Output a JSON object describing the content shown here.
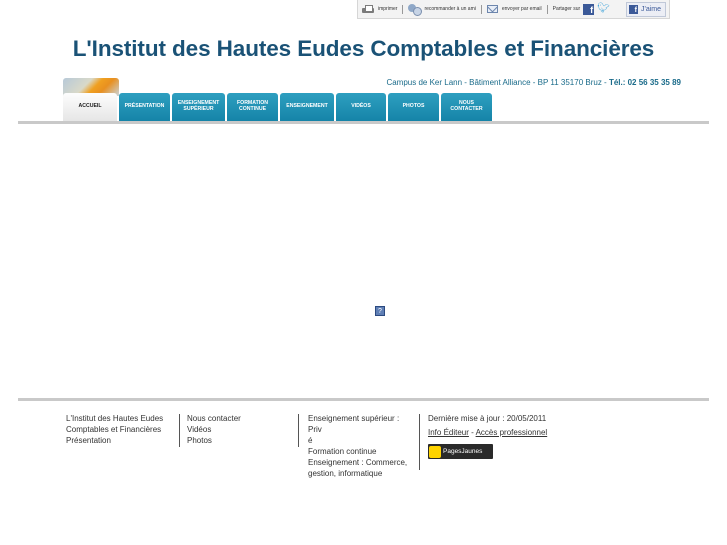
{
  "toolbar": {
    "print_label": "imprimer",
    "recommend_label": "recommander à un ami",
    "email_label": "envoyer par email",
    "share_label": "Partager sur",
    "like_label": "J'aime"
  },
  "header": {
    "title": "L'Institut des Hautes Eudes Comptables et Financières",
    "address": "Campus de Ker Lann - Bâtiment Alliance - BP 11 35170 Bruz - ",
    "phone": "Tél.: 02 56 35 35 89"
  },
  "nav": {
    "items": [
      {
        "label": "ACCUEIL"
      },
      {
        "label": "PRÉSENTATION"
      },
      {
        "label": "ENSEIGNEMENT SUPÉRIEUR"
      },
      {
        "label": "FORMATION CONTINUE"
      },
      {
        "label": "ENSEIGNEMENT"
      },
      {
        "label": "VIDÉOS"
      },
      {
        "label": "PHOTOS"
      },
      {
        "label": "NOUS CONTACTER"
      }
    ]
  },
  "main": {
    "broken_image_glyph": "?"
  },
  "footer": {
    "col1": [
      "L'Institut des Hautes Eudes",
      "Comptables et Financières",
      "Présentation"
    ],
    "col2": [
      "Nous contacter",
      "Vidéos",
      "Photos"
    ],
    "col3": [
      "Enseignement supérieur : Priv",
      "é",
      "Formation continue",
      "Enseignement : Commerce,",
      "gestion, informatique"
    ],
    "last_update": "Dernière mise à jour : 20/05/2011",
    "info_editor": "Info Éditeur",
    "separator": " - ",
    "pro_access": "Accès professionnel",
    "pj_label": "PagesJaunes"
  },
  "colors": {
    "title": "#1a5276",
    "nav_bg": "#1f93b7",
    "accent_text": "#1a6b8a"
  }
}
